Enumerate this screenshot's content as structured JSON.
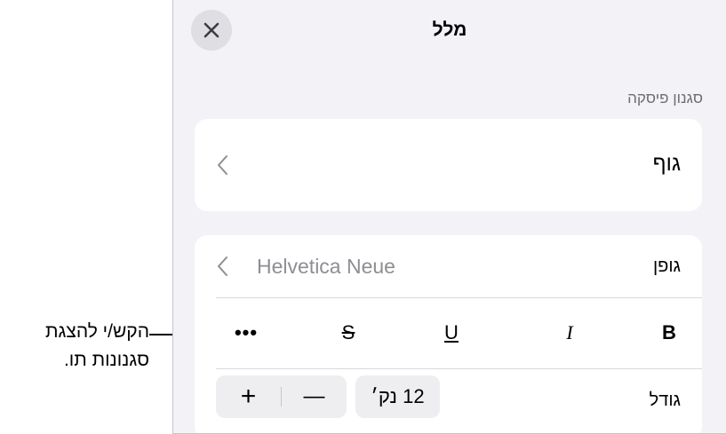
{
  "callout": {
    "line1": "הקש/י להצגת",
    "line2": "סגנונות תו."
  },
  "panel": {
    "title": "מלל",
    "close_icon": "close-icon",
    "paragraph_style": {
      "section_label": "סגנון פיסקה",
      "value": "גוף"
    },
    "font": {
      "label": "גופן",
      "value": "Helvetica Neue"
    },
    "format_buttons": {
      "bold": "B",
      "italic": "I",
      "underline": "U",
      "strikethrough": "S",
      "more": "•••"
    },
    "size": {
      "label": "גודל",
      "value": "12 נק׳",
      "increase": "+",
      "decrease": "—"
    }
  }
}
